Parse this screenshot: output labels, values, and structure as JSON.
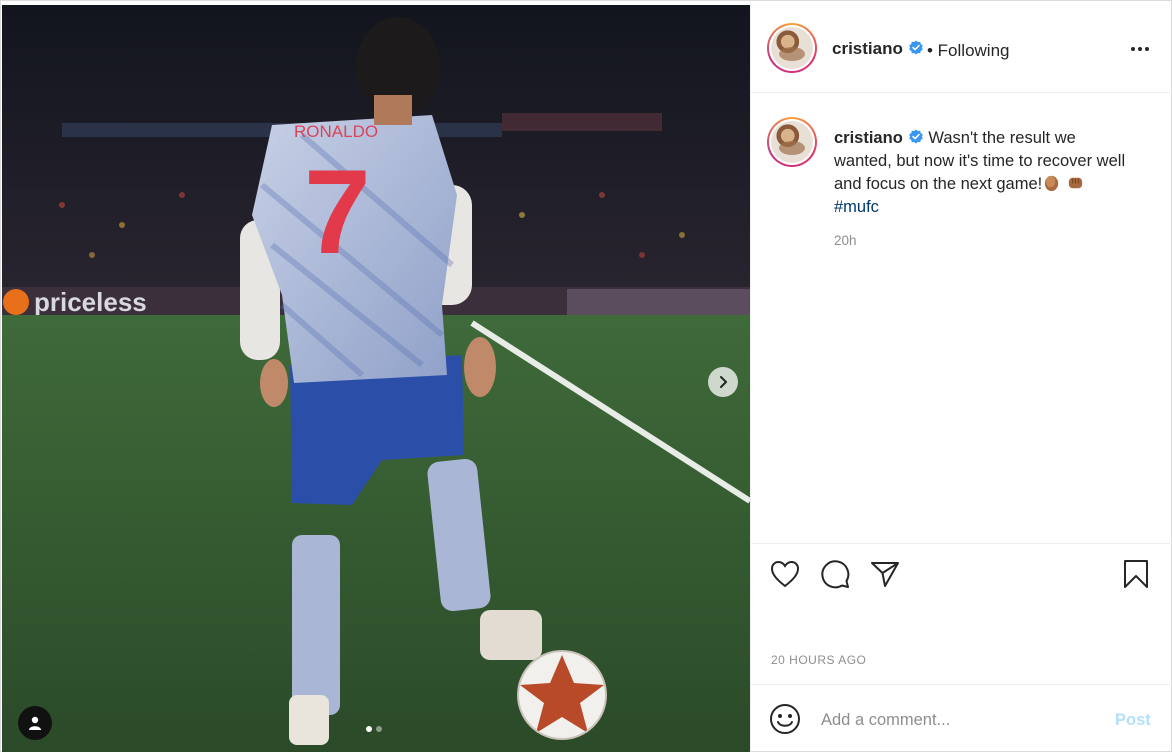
{
  "post": {
    "author": {
      "username": "cristiano",
      "verified": true
    },
    "following_label": "• Following",
    "caption": {
      "text": "Wasn't the result we wanted, but now it's time to recover well and focus on the next game!",
      "hashtag": "#mufc",
      "time": "20h"
    },
    "date": "20 HOURS AGO",
    "carousel": {
      "current": 1,
      "total": 2
    }
  },
  "media": {
    "jersey_name": "RONALDO",
    "jersey_number": "7",
    "board_text": "priceless"
  },
  "comment": {
    "placeholder": "Add a comment...",
    "post_label": "Post"
  },
  "icons": {
    "more": "more-horizontal-icon",
    "next": "chevron-right-icon",
    "user_tag": "user-tag-icon",
    "like": "heart-icon",
    "comment": "comment-bubble-icon",
    "share": "paper-plane-icon",
    "save": "bookmark-icon",
    "emoji": "smiley-face-icon"
  },
  "colors": {
    "verified": "#3897f0",
    "hashtag": "#00376b",
    "post_button_disabled": "#b2dffc",
    "muted_text": "#8e8e8e"
  }
}
